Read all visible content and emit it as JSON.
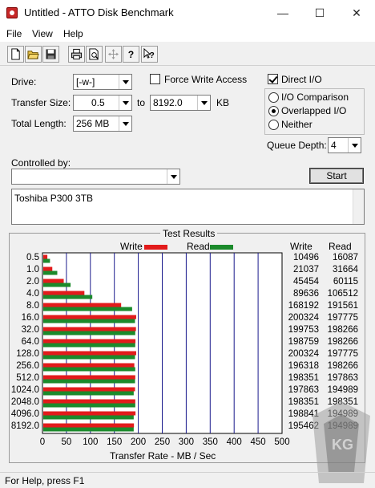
{
  "window": {
    "title": "Untitled - ATTO Disk Benchmark",
    "minimize": "—",
    "maximize": "☐",
    "close": "✕"
  },
  "menu": {
    "file": "File",
    "view": "View",
    "help": "Help"
  },
  "toolbar": {
    "buttons": [
      "new-file-icon",
      "open-folder-icon",
      "save-icon",
      "print-icon",
      "print-preview-icon",
      "move-icon",
      "help-icon",
      "context-help-icon"
    ]
  },
  "form": {
    "drive_label": "Drive:",
    "drive_value": "[-w-]",
    "force_write_access": "Force Write Access",
    "direct_io": "Direct I/O",
    "transfer_size_label": "Transfer Size:",
    "transfer_from": "0.5",
    "to_label": "to",
    "transfer_to": "8192.0",
    "kb_label": "KB",
    "total_length_label": "Total Length:",
    "total_length_value": "256 MB",
    "io_comparison": "I/O Comparison",
    "overlapped_io": "Overlapped I/O",
    "neither": "Neither",
    "queue_depth_label": "Queue Depth:",
    "queue_depth_value": "4",
    "controlled_by_label": "Controlled by:",
    "controlled_by_value": "",
    "start_button": "Start",
    "description": "Toshiba P300 3TB"
  },
  "results": {
    "title": "Test Results",
    "write_label": "Write",
    "read_label": "Read",
    "write_color": "#e21b1b",
    "read_color": "#1b8a2b",
    "col_write": "Write",
    "col_read": "Read",
    "x_axis_label": "Transfer Rate - MB / Sec",
    "x_ticks": [
      "0",
      "50",
      "100",
      "150",
      "200",
      "250",
      "300",
      "350",
      "400",
      "450",
      "500"
    ],
    "rows": [
      {
        "size": "0.5",
        "write": "10496",
        "read": "16087"
      },
      {
        "size": "1.0",
        "write": "21037",
        "read": "31664"
      },
      {
        "size": "2.0",
        "write": "45454",
        "read": "60115"
      },
      {
        "size": "4.0",
        "write": "89636",
        "read": "106512"
      },
      {
        "size": "8.0",
        "write": "168192",
        "read": "191561"
      },
      {
        "size": "16.0",
        "write": "200324",
        "read": "197775"
      },
      {
        "size": "32.0",
        "write": "199753",
        "read": "198266"
      },
      {
        "size": "64.0",
        "write": "198759",
        "read": "198266"
      },
      {
        "size": "128.0",
        "write": "200324",
        "read": "197775"
      },
      {
        "size": "256.0",
        "write": "196318",
        "read": "198266"
      },
      {
        "size": "512.0",
        "write": "198351",
        "read": "197863"
      },
      {
        "size": "1024.0",
        "write": "197863",
        "read": "194989"
      },
      {
        "size": "2048.0",
        "write": "198351",
        "read": "198351"
      },
      {
        "size": "4096.0",
        "write": "198841",
        "read": "194989"
      },
      {
        "size": "8192.0",
        "write": "195462",
        "read": "194989"
      }
    ]
  },
  "status": {
    "text": "For Help, press F1"
  },
  "watermark": {
    "text": "KG"
  },
  "chart_data": {
    "type": "bar",
    "orientation": "horizontal",
    "title": "Test Results",
    "xlabel": "Transfer Rate - MB / Sec",
    "xlim": [
      0,
      500
    ],
    "categories": [
      "0.5",
      "1.0",
      "2.0",
      "4.0",
      "8.0",
      "16.0",
      "32.0",
      "64.0",
      "128.0",
      "256.0",
      "512.0",
      "1024.0",
      "2048.0",
      "4096.0",
      "8192.0"
    ],
    "series": [
      {
        "name": "Write",
        "color": "#e21b1b",
        "values": [
          10.2,
          20.5,
          44.4,
          87.5,
          164.2,
          195.6,
          195.1,
          194.1,
          195.6,
          191.7,
          193.7,
          193.2,
          193.7,
          194.2,
          190.9
        ]
      },
      {
        "name": "Read",
        "color": "#1b8a2b",
        "values": [
          15.7,
          30.9,
          58.7,
          104.0,
          187.1,
          193.1,
          193.6,
          193.6,
          193.1,
          193.6,
          193.2,
          190.4,
          193.7,
          190.4,
          190.4
        ]
      }
    ],
    "grid": true
  }
}
